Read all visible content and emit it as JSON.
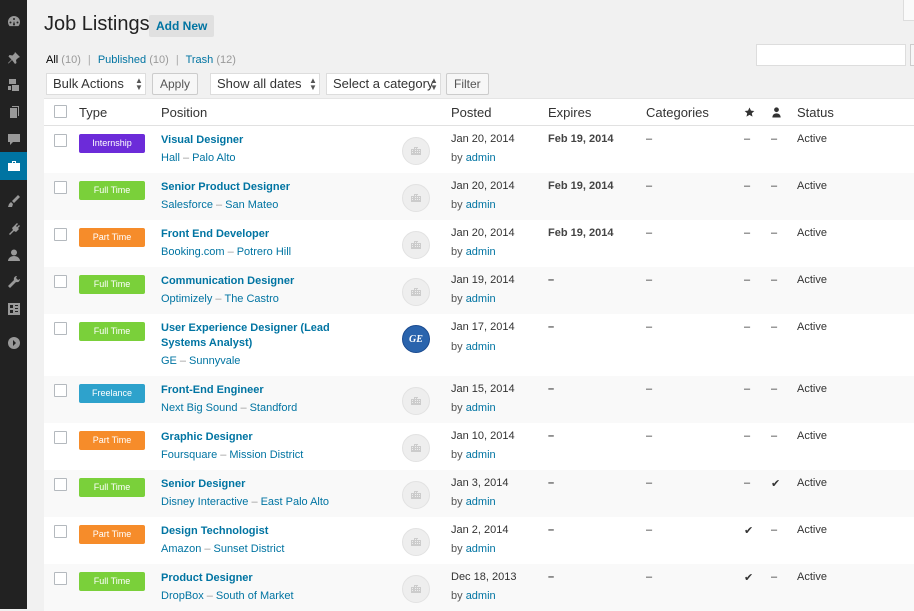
{
  "page": {
    "title": "Job Listings",
    "add_new_label": "Add New"
  },
  "filters": {
    "all_label": "All",
    "all_count": "(10)",
    "published_label": "Published",
    "published_count": "(10)",
    "trash_label": "Trash",
    "trash_count": "(12)",
    "separator": "|"
  },
  "toolbar": {
    "bulk_actions": "Bulk Actions",
    "apply": "Apply",
    "dates": "Show all dates",
    "category": "Select a category",
    "filter": "Filter"
  },
  "search": {
    "placeholder": ""
  },
  "columns": {
    "type": "Type",
    "position": "Position",
    "posted": "Posted",
    "expires": "Expires",
    "categories": "Categories",
    "featured_icon": "star-icon",
    "filled_icon": "person-icon",
    "status": "Status"
  },
  "colors": {
    "accent": "#0074a2",
    "internship": "#6c2bd9",
    "full_time": "#7ad03a",
    "part_time": "#f68c2a",
    "freelance": "#2ea2cc"
  },
  "rows": [
    {
      "type": "Internship",
      "type_key": "internship",
      "title": "Visual Designer",
      "company": "Hall",
      "location": "Palo Alto",
      "posted": "Jan 20, 2014",
      "by": "by",
      "author": "admin",
      "expires": "Feb 19, 2014",
      "categories": "–",
      "featured": "–",
      "filled": "–",
      "status": "Active",
      "logo": "placeholder"
    },
    {
      "type": "Full Time",
      "type_key": "full_time",
      "title": "Senior Product Designer",
      "company": "Salesforce",
      "location": "San Mateo",
      "posted": "Jan 20, 2014",
      "by": "by",
      "author": "admin",
      "expires": "Feb 19, 2014",
      "categories": "–",
      "featured": "–",
      "filled": "–",
      "status": "Active",
      "logo": "placeholder"
    },
    {
      "type": "Part Time",
      "type_key": "part_time",
      "title": "Front End Developer",
      "company": "Booking.com",
      "location": "Potrero Hill",
      "posted": "Jan 20, 2014",
      "by": "by",
      "author": "admin",
      "expires": "Feb 19, 2014",
      "categories": "–",
      "featured": "–",
      "filled": "–",
      "status": "Active",
      "logo": "placeholder"
    },
    {
      "type": "Full Time",
      "type_key": "full_time",
      "title": "Communication Designer",
      "company": "Optimizely",
      "location": "The Castro",
      "posted": "Jan 19, 2014",
      "by": "by",
      "author": "admin",
      "expires": "–",
      "categories": "–",
      "featured": "–",
      "filled": "–",
      "status": "Active",
      "logo": "placeholder"
    },
    {
      "type": "Full Time",
      "type_key": "full_time",
      "title": "User Experience Designer (Lead Systems Analyst)",
      "company": "GE",
      "location": "Sunnyvale",
      "posted": "Jan 17, 2014",
      "by": "by",
      "author": "admin",
      "expires": "–",
      "categories": "–",
      "featured": "–",
      "filled": "–",
      "status": "Active",
      "logo": "ge",
      "logo_text": "GE"
    },
    {
      "type": "Freelance",
      "type_key": "freelance",
      "title": "Front-End Engineer",
      "company": "Next Big Sound",
      "location": "Standford",
      "posted": "Jan 15, 2014",
      "by": "by",
      "author": "admin",
      "expires": "–",
      "categories": "–",
      "featured": "–",
      "filled": "–",
      "status": "Active",
      "logo": "placeholder"
    },
    {
      "type": "Part Time",
      "type_key": "part_time",
      "title": "Graphic Designer",
      "company": "Foursquare",
      "location": "Mission District",
      "posted": "Jan 10, 2014",
      "by": "by",
      "author": "admin",
      "expires": "–",
      "categories": "–",
      "featured": "–",
      "filled": "–",
      "status": "Active",
      "logo": "placeholder"
    },
    {
      "type": "Full Time",
      "type_key": "full_time",
      "title": "Senior Designer",
      "company": "Disney Interactive",
      "location": "East Palo Alto",
      "posted": "Jan 3, 2014",
      "by": "by",
      "author": "admin",
      "expires": "–",
      "categories": "–",
      "featured": "–",
      "filled": "✔",
      "status": "Active",
      "logo": "placeholder"
    },
    {
      "type": "Part Time",
      "type_key": "part_time",
      "title": "Design Technologist",
      "company": "Amazon",
      "location": "Sunset District",
      "posted": "Jan 2, 2014",
      "by": "by",
      "author": "admin",
      "expires": "–",
      "categories": "–",
      "featured": "✔",
      "filled": "–",
      "status": "Active",
      "logo": "placeholder"
    },
    {
      "type": "Full Time",
      "type_key": "full_time",
      "title": "Product Designer",
      "company": "DropBox",
      "location": "South of Market",
      "posted": "Dec 18, 2013",
      "by": "by",
      "author": "admin",
      "expires": "–",
      "categories": "–",
      "featured": "✔",
      "filled": "–",
      "status": "Active",
      "logo": "placeholder"
    }
  ]
}
